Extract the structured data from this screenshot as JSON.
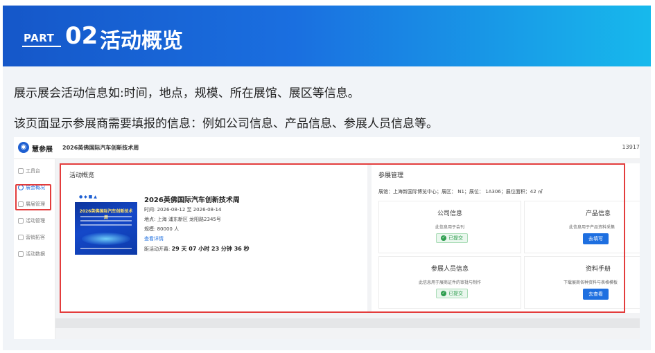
{
  "banner": {
    "part_label": "PART",
    "part_number": "02",
    "title": "活动概览",
    "color_start": "#1557c9",
    "color_end": "#17b9ec"
  },
  "description": {
    "line1": "展示展会活动信息如:时间，地点，规模、所在展馆、展区等信息。",
    "line2": "该页面显示参展商需要填报的信息：例如公司信息、产品信息、参展人员信息等。"
  },
  "app": {
    "logo_text": "慧参展",
    "event_name": "2026英佛国际汽车创新技术周",
    "phone": "13917",
    "sidebar": [
      {
        "label": "工具台",
        "icon": "grid-icon",
        "active": false
      },
      {
        "label": "展会概况",
        "icon": "clock-icon",
        "active": true
      },
      {
        "label": "展届管理",
        "icon": "document-icon",
        "active": false
      },
      {
        "label": "活动管理",
        "icon": "calendar-icon",
        "active": false
      },
      {
        "label": "营销拓客",
        "icon": "briefcase-icon",
        "active": false
      },
      {
        "label": "活动数据",
        "icon": "bar-chart-icon",
        "active": false
      }
    ],
    "overview": {
      "panel_title": "活动概览",
      "event_title": "2026英佛国际汽车创新技术周",
      "time_label": "时间:",
      "time_value": "2026-08-12 至 2026-08-14",
      "location_label": "地点:",
      "location_value": "上海 浦东新区 龙阳路2345号",
      "scale_label": "规模:",
      "scale_value": "80000 人",
      "details_link": "查看详情",
      "countdown_label": "距活动开幕:",
      "countdown_value": "29 天 07 小时 23 分钟 36 秒",
      "poster_title": "2026英佛国际汽车创新技术周"
    },
    "management": {
      "panel_title": "参展管理",
      "location_info": "展馆：上海新国际博览中心；展区： N1；展位： 1A306；展位面积：42 ㎡",
      "cards": [
        {
          "title": "公司信息",
          "desc": "此信息用于会刊",
          "action": "已提交",
          "action_type": "badge"
        },
        {
          "title": "产品信息",
          "desc": "此信息用于产品资料采集",
          "action": "去填写",
          "action_type": "button"
        },
        {
          "title": "参展人员信息",
          "desc": "此信息用于展商证件的审批与制作",
          "action": "已提交",
          "action_type": "badge"
        },
        {
          "title": "资料手册",
          "desc": "下载展商各种资料与表格模板",
          "action": "去查看",
          "action_type": "button"
        }
      ]
    }
  }
}
